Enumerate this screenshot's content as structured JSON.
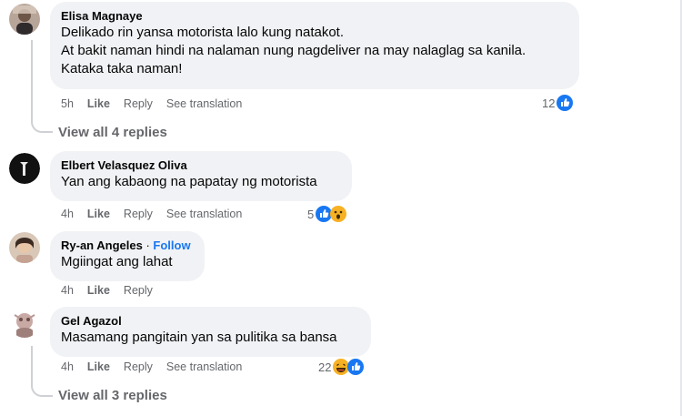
{
  "comments": [
    {
      "author": "Elisa Magnaye",
      "lines": [
        "Delikado rin yansa motorista lalo kung natakot.",
        "At bakit naman hindi na nalaman nung nagdeliver na may nalaglag sa kanila.",
        "Kataka taka naman!"
      ],
      "time": "5h",
      "like": "Like",
      "reply": "Reply",
      "translate": "See translation",
      "reaction_count": "12",
      "reactions": [
        "like-icon"
      ]
    },
    {
      "author": "Elbert Velasquez Oliva",
      "lines": [
        "Yan ang kabaong na papatay ng motorista"
      ],
      "time": "4h",
      "like": "Like",
      "reply": "Reply",
      "translate": "See translation",
      "reaction_count": "5",
      "reactions": [
        "like-icon",
        "wow-icon"
      ]
    },
    {
      "author": "Ry-an Angeles",
      "follow": "Follow",
      "separator": "·",
      "lines": [
        "Mgiingat ang lahat"
      ],
      "time": "4h",
      "like": "Like",
      "reply": "Reply"
    },
    {
      "author": "Gel Agazol",
      "lines": [
        "Masamang pangitain yan sa pulitika sa bansa"
      ],
      "time": "4h",
      "like": "Like",
      "reply": "Reply",
      "translate": "See translation",
      "reaction_count": "22",
      "reactions": [
        "haha-icon",
        "like-icon"
      ]
    }
  ],
  "view_replies_1": "View all 4 replies",
  "view_replies_2": "View all 3 replies",
  "colors": {
    "bubble": "#f0f2f5",
    "like_blue": "#1877f2",
    "meta_gray": "#65676b",
    "wow_yellow": "#f7b125"
  }
}
